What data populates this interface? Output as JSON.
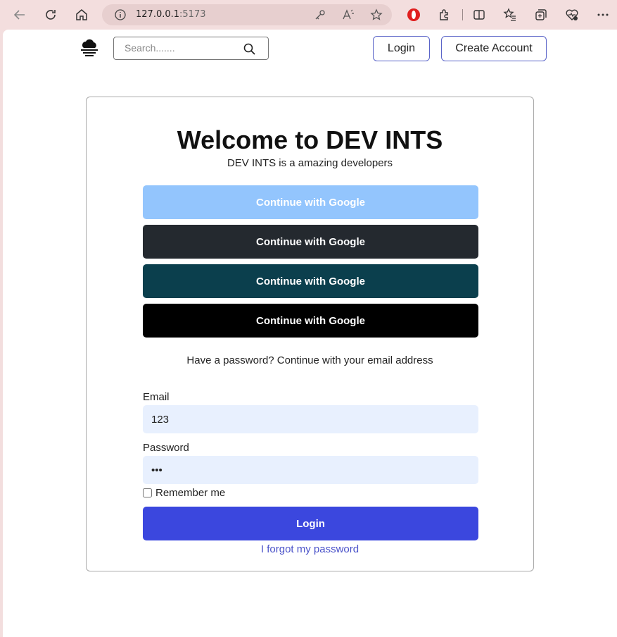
{
  "browser": {
    "url_host": "127.0.0.1",
    "url_port": ":5173"
  },
  "header": {
    "search_placeholder": "Search.......",
    "login_label": "Login",
    "create_account_label": "Create Account"
  },
  "card": {
    "title": "Welcome to DEV INTS",
    "subtitle": "DEV INTS is a amazing developers",
    "oauth_buttons": [
      {
        "label": "Continue with Google",
        "color": "#93c5fd"
      },
      {
        "label": "Continue with Google",
        "color": "#24292f"
      },
      {
        "label": "Continue with Google",
        "color": "#0b3f4d"
      },
      {
        "label": "Continue with Google",
        "color": "#000000"
      }
    ],
    "alt_text": "Have a password? Continue with your email address",
    "email_label": "Email",
    "email_value": "123",
    "password_label": "Password",
    "password_value": "123",
    "remember_label": "Remember me",
    "login_button_label": "Login",
    "forgot_label": "I forgot my password"
  },
  "colors": {
    "accent": "#3b47de",
    "link": "#4a52c9",
    "input_bg": "#e8f0fe"
  }
}
